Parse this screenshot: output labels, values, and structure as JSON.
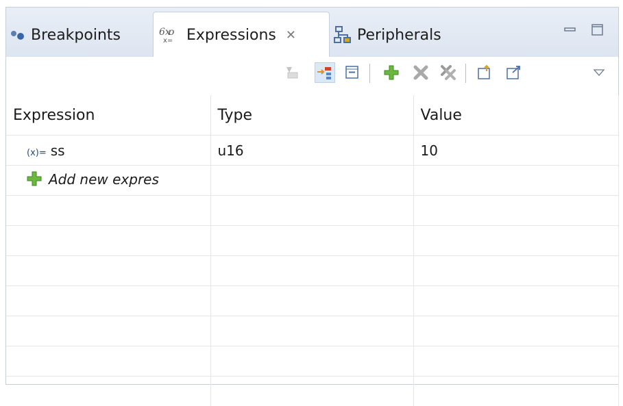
{
  "tabs": [
    {
      "label": "Breakpoints",
      "icon": "breakpoints-icon"
    },
    {
      "label": "Expressions",
      "icon": "expressions-icon",
      "active": true
    },
    {
      "label": "Peripherals",
      "icon": "peripherals-icon"
    }
  ],
  "table": {
    "headers": [
      "Expression",
      "Type",
      "Value"
    ],
    "rows": [
      {
        "prefix": "(x)=",
        "expression": "ss",
        "type": "u16",
        "value": "10"
      }
    ],
    "add_placeholder": "Add new expres"
  },
  "colors": {
    "tabbar": "#e2e8f2",
    "accent_green": "#5aa832",
    "grid": "#e6e6e6"
  }
}
